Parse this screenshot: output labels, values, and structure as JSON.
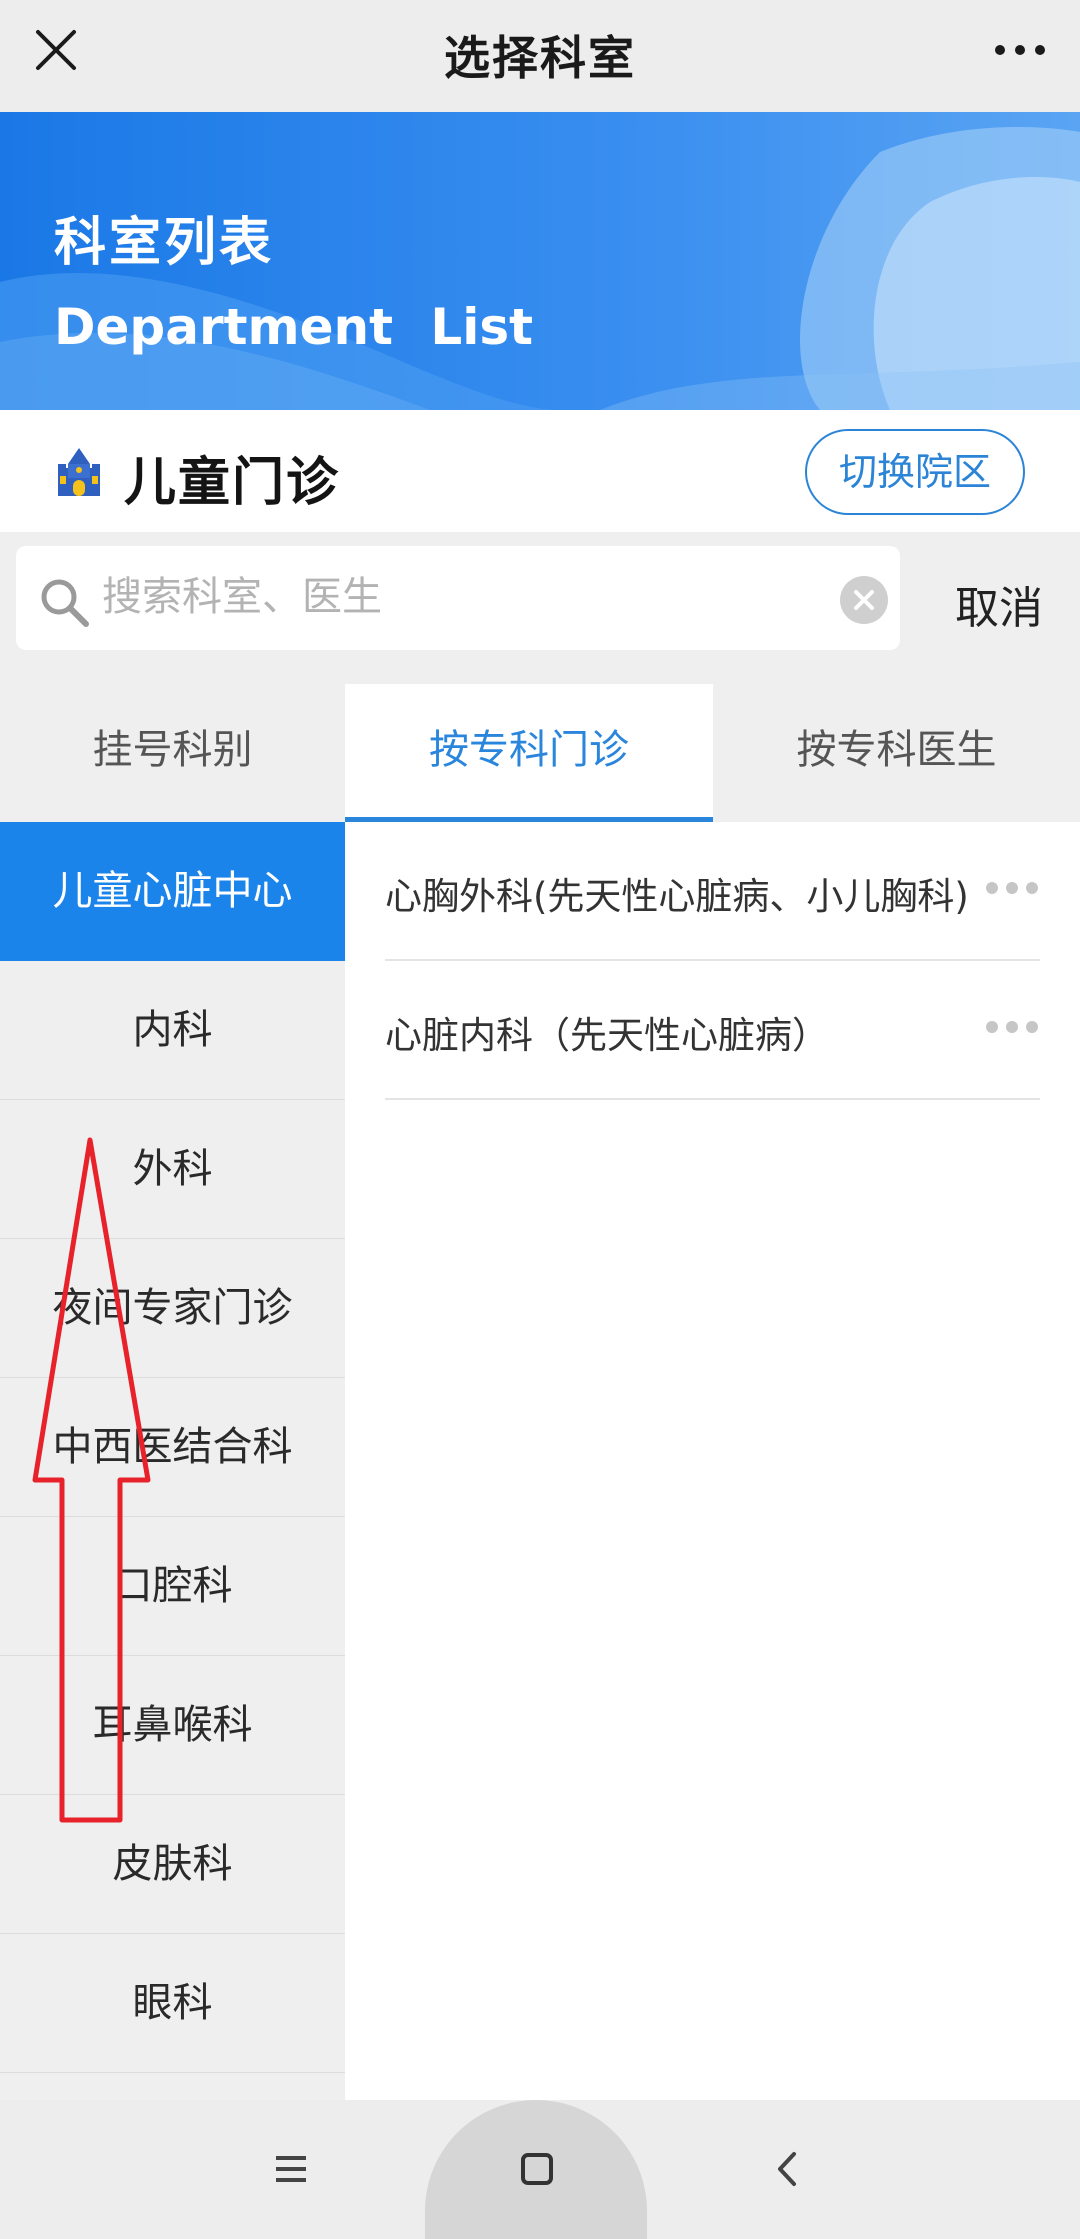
{
  "title_bar": {
    "title": "选择科室",
    "close_icon": "close-icon",
    "more_icon": "more-icon"
  },
  "banner": {
    "title_cn": "科室列表",
    "title_en": "Department  List",
    "color": "#1a78e6"
  },
  "hospital": {
    "name": "儿童门诊",
    "switch_label": "切换院区",
    "icon": "castle-icon"
  },
  "search": {
    "placeholder": "搜索科室、医生",
    "value": "",
    "cancel_label": "取消"
  },
  "tabs": [
    {
      "label": "挂号科别",
      "active": false
    },
    {
      "label": "按专科门诊",
      "active": true
    },
    {
      "label": "按专科医生",
      "active": false
    }
  ],
  "sidebar": {
    "items": [
      {
        "label": "儿童心脏中心",
        "active": true
      },
      {
        "label": "内科",
        "active": false
      },
      {
        "label": "外科",
        "active": false
      },
      {
        "label": "夜间专家门诊",
        "active": false
      },
      {
        "label": "中西医结合科",
        "active": false
      },
      {
        "label": "口腔科",
        "active": false
      },
      {
        "label": "耳鼻喉科",
        "active": false
      },
      {
        "label": "皮肤科",
        "active": false
      },
      {
        "label": "眼科",
        "active": false
      }
    ]
  },
  "departments": [
    {
      "label": "心胸外科(先天性心脏病、小儿胸科)"
    },
    {
      "label": "心脏内科（先天性心脏病）"
    }
  ],
  "nav_bar": {
    "menu_icon": "menu-icon",
    "home_icon": "home-icon",
    "back_icon": "back-icon"
  },
  "colors": {
    "accent": "#2a86dc",
    "sidebar_active": "#1a84ea",
    "annotation": "#e8222a"
  }
}
